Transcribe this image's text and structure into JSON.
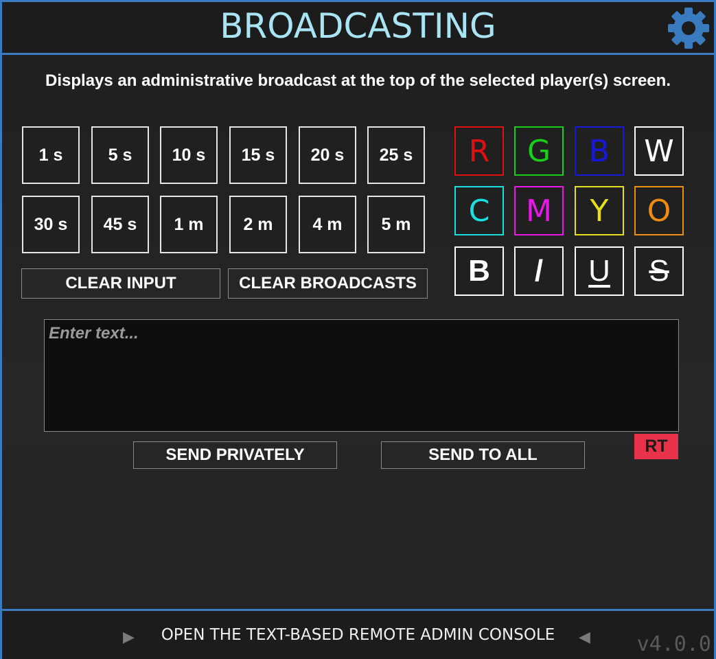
{
  "header": {
    "title": "BROADCASTING",
    "settings_icon": "gear-icon",
    "accent_color": "#3a7bbf"
  },
  "description": "Displays an administrative broadcast at the top of the selected player(s) screen.",
  "durations": {
    "row1": [
      "1 s",
      "5 s",
      "10 s",
      "15 s",
      "20 s",
      "25 s"
    ],
    "row2": [
      "30 s",
      "45 s",
      "1 m",
      "2 m",
      "4 m",
      "5 m"
    ]
  },
  "colors": [
    {
      "label": "R",
      "color": "#e01010"
    },
    {
      "label": "G",
      "color": "#18d018"
    },
    {
      "label": "B",
      "color": "#1818d8"
    },
    {
      "label": "W",
      "color": "#ffffff"
    },
    {
      "label": "C",
      "color": "#18e0e0"
    },
    {
      "label": "M",
      "color": "#e818e8"
    },
    {
      "label": "Y",
      "color": "#e8e018"
    },
    {
      "label": "O",
      "color": "#f08c10"
    }
  ],
  "formatting": {
    "bold": "B",
    "italic": "/",
    "underline": "U",
    "strikethrough": "S"
  },
  "actions": {
    "clear_input": "CLEAR INPUT",
    "clear_broadcasts": "CLEAR BROADCASTS",
    "send_privately": "SEND PRIVATELY",
    "send_to_all": "SEND TO ALL"
  },
  "input": {
    "placeholder": "Enter text...",
    "value": ""
  },
  "rt_badge": "RT",
  "footer": {
    "console_link": "OPEN THE TEXT-BASED REMOTE ADMIN CONSOLE",
    "left_arrow": "▶",
    "right_arrow": "◀",
    "version": "v4.0.0"
  }
}
